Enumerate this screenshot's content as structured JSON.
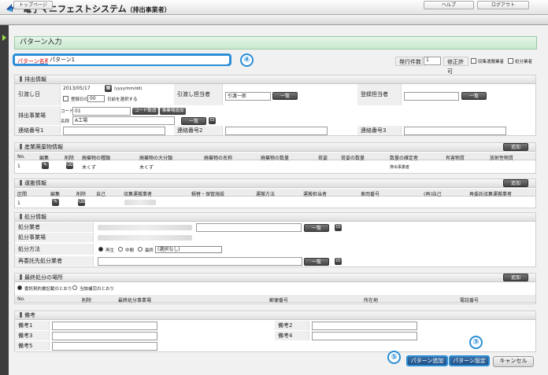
{
  "app": {
    "title": "電子マニフェストシステム",
    "subtitle": "（排出事業者）",
    "logo_text": "JWNET"
  },
  "nav": {
    "top": "トップページ",
    "help": "ヘルプ",
    "logout": "ログアウト"
  },
  "page_title": "パターン入力",
  "pattern": {
    "name_label": "パターン名称",
    "name_value": "パターン1"
  },
  "issue": {
    "count_label": "発行件数",
    "count_value": "1",
    "correction_label": "修正許可",
    "opt1": "収集運搬業者",
    "opt2": "処分業者"
  },
  "sections": {
    "emission": {
      "title": "排出情報",
      "date_label": "引渡し日",
      "date_value": "2013/05/17",
      "date_format": "(yyyy/mm/dd)",
      "auto_label": "登録日の",
      "auto_day": "00",
      "auto_suffix": "日前を選択する",
      "handover_label": "引渡し担当者",
      "handover_value": "引渡一郎",
      "registrant_label": "登録担当者",
      "list_btn": "一覧",
      "site_label": "排出事業場",
      "code_label": "コード",
      "code_value": "01",
      "code_cancel": "コード取消",
      "site_add": "事業場追加",
      "name_label": "名称",
      "name_value": "A工場",
      "contact1": "連絡番号1",
      "contact2": "連絡番号2",
      "contact3": "連絡番号3"
    },
    "waste": {
      "title": "産業廃棄物情報",
      "add": "追加",
      "columns": [
        "No.",
        "編集",
        "削除",
        "廃棄物の種類",
        "廃棄物の大分類",
        "廃棄物の名称",
        "廃棄物の数量",
        "荷姿",
        "荷姿の数量",
        "数量の確定者",
        "有害物質",
        "放射性物質"
      ],
      "rows": [
        {
          "no": "1",
          "type": "木くず",
          "major": "木くず",
          "confirmer": "排出事業者"
        }
      ]
    },
    "transport": {
      "title": "運搬情報",
      "add": "追加",
      "columns": [
        "区間",
        "編集",
        "削除",
        "自己",
        "収集運搬業者",
        "積替・保管施設",
        "運搬方法",
        "運搬担当者",
        "車両番号",
        "(再)自己",
        "再委託収集運搬業者"
      ],
      "rows": [
        {
          "no": "1"
        }
      ]
    },
    "disposal": {
      "title": "処分情報",
      "company_label": "処分業者",
      "site_label": "処分事業場",
      "method_label": "処分方法",
      "method_opts": [
        "再生",
        "中間",
        "最終"
      ],
      "method_select": "(選択なし)",
      "resub_label": "再委託先処分業者",
      "list_btn": "一覧"
    },
    "final": {
      "title": "最終処分の場所",
      "add": "追加",
      "opt1": "委託契約書記載のとおり",
      "opt2": "当該補完のとおり",
      "columns": [
        "No.",
        "削除",
        "最終処分事業場",
        "郵便番号",
        "所在地",
        "電話番号"
      ]
    },
    "remarks": {
      "title": "備考",
      "labels": [
        "備考1",
        "備考2",
        "備考3",
        "備考4",
        "備考5"
      ]
    }
  },
  "footer": {
    "add_pattern": "パターン追加",
    "set_pattern": "パターン設定",
    "cancel": "キャンセル"
  },
  "callouts": {
    "c3": "③",
    "c4": "④",
    "c5": "⑤"
  }
}
